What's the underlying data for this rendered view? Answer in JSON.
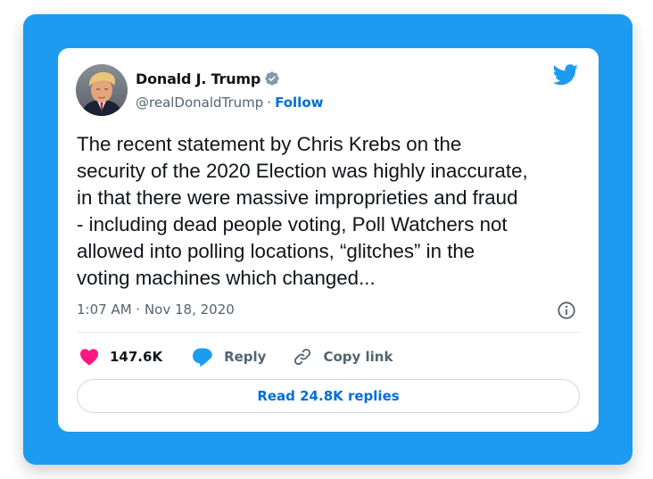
{
  "tweet": {
    "author": {
      "name": "Donald J. Trump",
      "handle": "@realDonaldTrump",
      "separator": "·",
      "follow_label": "Follow"
    },
    "text": "The recent statement by Chris Krebs on the\nsecurity of the 2020 Election was highly inaccurate,\nin that there were massive improprieties and fraud\n- including dead people voting, Poll Watchers not\nallowed into polling locations, “glitches” in the\nvoting machines which changed...",
    "timestamp": "1:07 AM · Nov 18, 2020",
    "actions": {
      "likes": "147.6K",
      "reply_label": "Reply",
      "copy_link_label": "Copy link"
    },
    "read_replies_label": "Read 24.8K replies"
  },
  "colors": {
    "frame_background": "#1d9bf0",
    "twitter_blue": "#1d9bf0",
    "link_blue": "#006fd6",
    "like_pink": "#f91880",
    "text_primary": "#0f1419",
    "text_secondary": "#536471"
  },
  "icons": {
    "brand": "twitter-bird-icon",
    "verified": "verified-badge-icon",
    "info": "info-icon",
    "like": "heart-icon",
    "reply": "speech-bubble-icon",
    "copy_link": "link-icon"
  }
}
